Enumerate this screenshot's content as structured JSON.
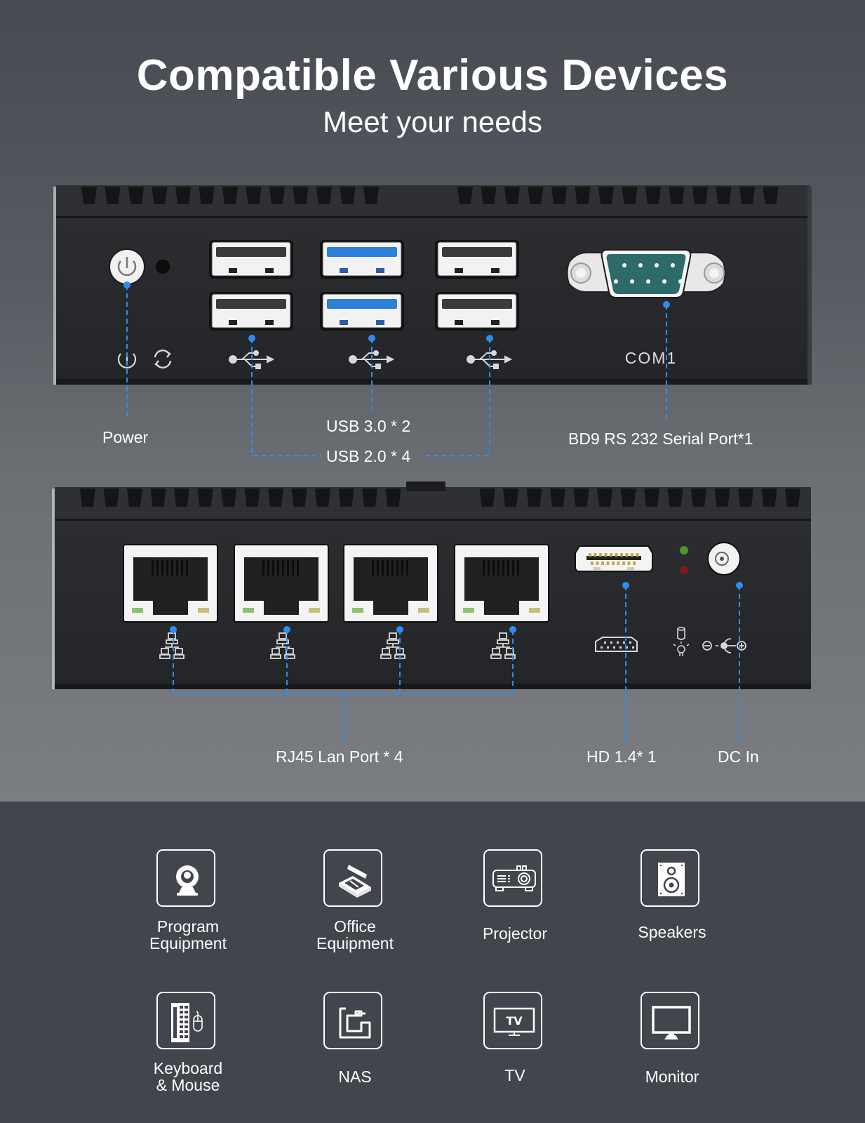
{
  "header": {
    "title": "Compatible Various Devices",
    "subtitle": "Meet your needs"
  },
  "colors": {
    "accent": "#2f8cf0",
    "device_body": "#26282b",
    "usb3_blue": "#2e7fd8",
    "serial_teal": "#2d6a6a"
  },
  "front_panel": {
    "port_labels": {
      "com1": "COM1"
    },
    "callouts": {
      "power": "Power",
      "usb3": "USB 3.0 * 2",
      "usb2": "USB 2.0 * 4",
      "serial": "BD9 RS 232 Serial Port*1"
    }
  },
  "rear_panel": {
    "callouts": {
      "rj45": "RJ45 Lan Port * 4",
      "hdmi": "HD 1.4* 1",
      "dc": "DC In"
    }
  },
  "devices": [
    {
      "label_lines": [
        "Program",
        "Equipment"
      ],
      "icon": "webcam-icon"
    },
    {
      "label_lines": [
        "Office",
        "Equipment"
      ],
      "icon": "scanner-icon"
    },
    {
      "label_lines": [
        "Projector"
      ],
      "icon": "projector-icon"
    },
    {
      "label_lines": [
        "Speakers"
      ],
      "icon": "speaker-icon"
    },
    {
      "label_lines": [
        "Keyboard",
        "& Mouse"
      ],
      "icon": "keyboard-mouse-icon"
    },
    {
      "label_lines": [
        "NAS"
      ],
      "icon": "nas-icon"
    },
    {
      "label_lines": [
        "TV"
      ],
      "icon": "tv-icon",
      "icon_text": "TV"
    },
    {
      "label_lines": [
        "Monitor"
      ],
      "icon": "monitor-icon"
    }
  ]
}
